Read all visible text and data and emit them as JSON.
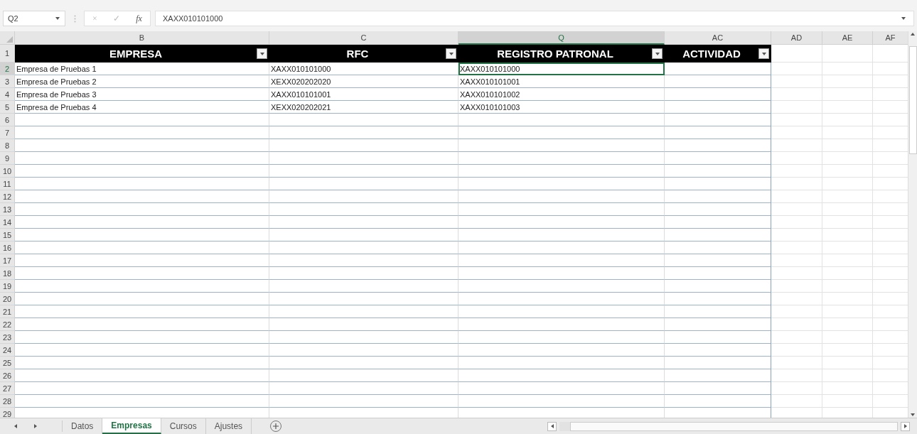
{
  "name_box": "Q2",
  "formula_buttons": [
    "×",
    "✓",
    "fx"
  ],
  "formula": "XAXX010101000",
  "columns": [
    {
      "label": "B",
      "selected": false
    },
    {
      "label": "C",
      "selected": false
    },
    {
      "label": "Q",
      "selected": true
    },
    {
      "label": "AC",
      "selected": false
    },
    {
      "label": "AD",
      "selected": false
    },
    {
      "label": "AE",
      "selected": false
    },
    {
      "label": "AF",
      "selected": false
    }
  ],
  "table_headers": [
    "EMPRESA",
    "RFC",
    "REGISTRO PATRONAL",
    "ACTIVIDAD"
  ],
  "header_row_number": "1",
  "rows": [
    {
      "number": "2",
      "cells": [
        {
          "text": "Empresa de Pruebas 1",
          "selected": false
        },
        {
          "text": "XAXX010101000",
          "selected": false
        },
        {
          "text": "XAXX010101000",
          "selected": true
        }
      ]
    },
    {
      "number": "3",
      "cells": [
        {
          "text": "Empresa de Pruebas 2",
          "selected": false
        },
        {
          "text": "XEXX020202020",
          "selected": false
        },
        {
          "text": "XAXX010101001",
          "selected": false
        }
      ]
    },
    {
      "number": "4",
      "cells": [
        {
          "text": "Empresa de Pruebas 3",
          "selected": false
        },
        {
          "text": "XAXX010101001",
          "selected": false
        },
        {
          "text": "XAXX010101002",
          "selected": false
        }
      ]
    },
    {
      "number": "5",
      "cells": [
        {
          "text": "Empresa de Pruebas 4",
          "selected": false
        },
        {
          "text": "XEXX020202021",
          "selected": false
        },
        {
          "text": "XAXX010101003",
          "selected": false
        }
      ]
    },
    {
      "number": "6"
    },
    {
      "number": "7"
    },
    {
      "number": "8"
    },
    {
      "number": "9"
    },
    {
      "number": "10"
    },
    {
      "number": "11"
    },
    {
      "number": "12"
    },
    {
      "number": "13"
    },
    {
      "number": "14"
    },
    {
      "number": "15"
    },
    {
      "number": "16"
    },
    {
      "number": "17"
    },
    {
      "number": "18"
    },
    {
      "number": "19"
    },
    {
      "number": "20"
    },
    {
      "number": "21"
    },
    {
      "number": "22"
    },
    {
      "number": "23"
    },
    {
      "number": "24"
    },
    {
      "number": "25"
    },
    {
      "number": "26"
    },
    {
      "number": "27"
    },
    {
      "number": "28"
    },
    {
      "number": "29"
    }
  ],
  "sheets": [
    {
      "label": "Datos",
      "selected": false
    },
    {
      "label": "Empresas",
      "selected": true
    },
    {
      "label": "Cursos",
      "selected": false
    },
    {
      "label": "Ajustes",
      "selected": false
    }
  ]
}
